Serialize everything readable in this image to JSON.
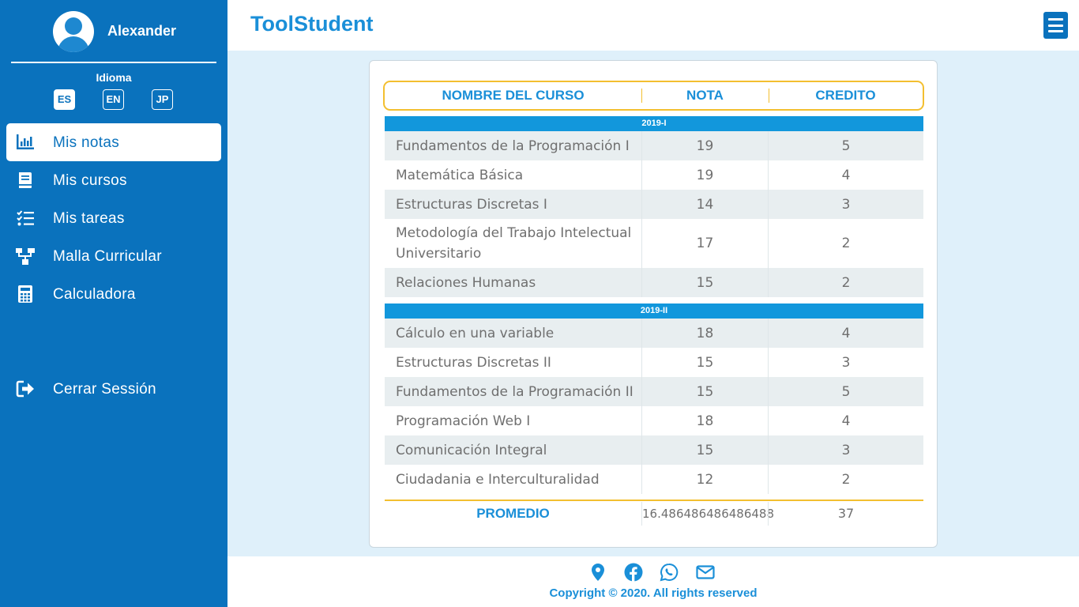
{
  "user": {
    "name": "Alexander"
  },
  "language": {
    "title": "Idioma",
    "options": [
      "ES",
      "EN",
      "JP"
    ],
    "selected": "ES"
  },
  "nav": {
    "items": [
      {
        "label": "Mis notas",
        "icon": "bar-chart-icon",
        "active": true
      },
      {
        "label": "Mis cursos",
        "icon": "book-icon"
      },
      {
        "label": "Mis tareas",
        "icon": "checklist-icon"
      },
      {
        "label": "Malla Curricular",
        "icon": "sitemap-icon"
      },
      {
        "label": "Calculadora",
        "icon": "calculator-icon"
      }
    ],
    "logout": {
      "label": "Cerrar Sessión",
      "icon": "sign-out-icon"
    }
  },
  "header": {
    "brand": "ToolStudent",
    "menu_icon": "hamburger-menu-icon"
  },
  "table": {
    "headers": {
      "course": "NOMBRE DEL CURSO",
      "grade": "NOTA",
      "credit": "CREDITO"
    },
    "semesters": [
      {
        "label": "2019-I",
        "courses": [
          {
            "name": "Fundamentos de la Programación I",
            "grade": "19",
            "credit": "5"
          },
          {
            "name": "Matemática Básica",
            "grade": "19",
            "credit": "4"
          },
          {
            "name": "Estructuras Discretas I",
            "grade": "14",
            "credit": "3"
          },
          {
            "name": "Metodología del Trabajo Intelectual Universitario",
            "grade": "17",
            "credit": "2"
          },
          {
            "name": "Relaciones Humanas",
            "grade": "15",
            "credit": "2"
          }
        ]
      },
      {
        "label": "2019-II",
        "courses": [
          {
            "name": "Cálculo en una variable",
            "grade": "18",
            "credit": "4"
          },
          {
            "name": "Estructuras Discretas II",
            "grade": "15",
            "credit": "3"
          },
          {
            "name": "Fundamentos de la Programación II",
            "grade": "15",
            "credit": "5"
          },
          {
            "name": "Programación Web I",
            "grade": "18",
            "credit": "4"
          },
          {
            "name": "Comunicación Integral",
            "grade": "15",
            "credit": "3"
          },
          {
            "name": "Ciudadania e Interculturalidad",
            "grade": "12",
            "credit": "2"
          }
        ]
      }
    ],
    "summary": {
      "label": "PROMEDIO",
      "grade": "16.486486486486488",
      "credit": "37"
    }
  },
  "footer": {
    "icons": [
      "map-marker-icon",
      "facebook-icon",
      "whatsapp-icon",
      "envelope-icon"
    ],
    "copyright": "Copyright © 2020. All rights reserved"
  },
  "colors": {
    "sidebar": "#0a72bd",
    "accent": "#1a8fd8",
    "border": "#f3bf30",
    "semester_bar": "#1297dc",
    "background": "#dff0fa"
  }
}
